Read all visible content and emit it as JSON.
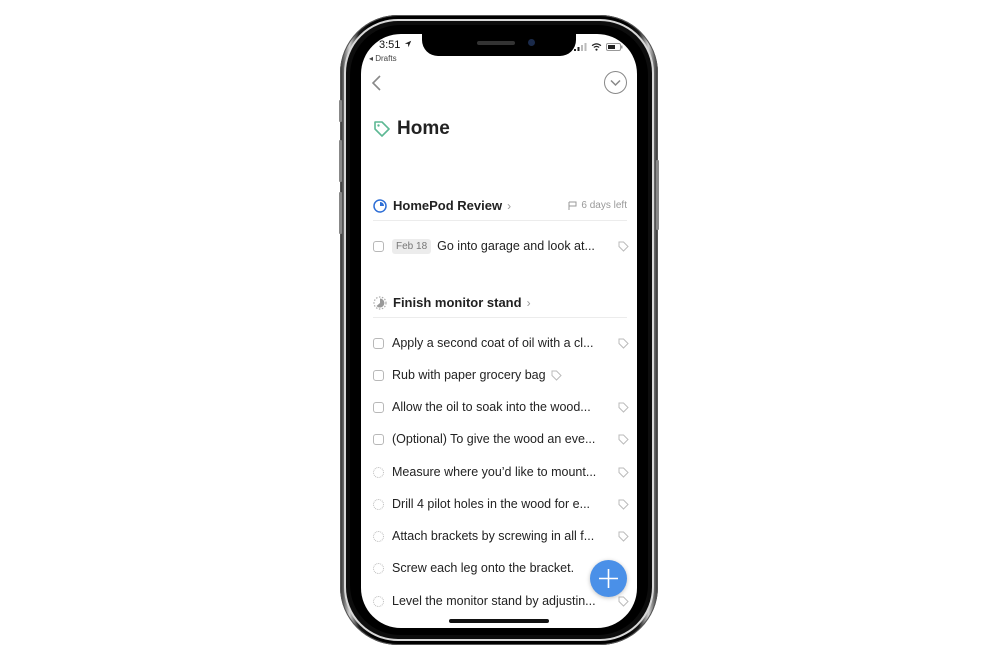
{
  "status_bar": {
    "time": "3:51",
    "back_app": "◂ Drafts",
    "location_icon": "location-arrow-icon",
    "signal_icon": "signal-icon",
    "wifi_icon": "wifi-icon",
    "battery_icon": "battery-icon"
  },
  "nav": {
    "back_icon": "chevron-left-icon",
    "menu_icon": "chevron-down-circle-icon"
  },
  "page": {
    "title": "Home",
    "title_icon": "tag-icon",
    "title_icon_color": "#5cb893"
  },
  "projects": [
    {
      "name": "HomePod Review",
      "chevron": "›",
      "icon": "progress-pie-icon",
      "icon_color": "#2f6fd6",
      "deadline": "6 days left",
      "tasks": [
        {
          "date": "Feb 18",
          "text": "Go into garage and look at...",
          "checkbox": "square"
        }
      ]
    },
    {
      "name": "Finish monitor stand",
      "chevron": "›",
      "icon": "progress-pie-icon",
      "icon_color": "#999999",
      "deadline": "",
      "tasks": [
        {
          "text": "Apply a second coat of oil with a cl...",
          "checkbox": "square"
        },
        {
          "text": "Rub with paper grocery bag",
          "checkbox": "square"
        },
        {
          "text": "Allow the oil to soak into the wood...",
          "checkbox": "square"
        },
        {
          "text": "(Optional) To give the wood an eve...",
          "checkbox": "square"
        },
        {
          "text": "Measure where you’d like to mount...",
          "checkbox": "dashed"
        },
        {
          "text": "Drill 4 pilot holes in the wood for e...",
          "checkbox": "dashed"
        },
        {
          "text": "Attach brackets by screwing in all f...",
          "checkbox": "dashed"
        },
        {
          "text": "Screw each leg onto the bracket.",
          "checkbox": "dashed"
        },
        {
          "text": "Level the monitor stand by adjustin...",
          "checkbox": "dashed"
        }
      ]
    }
  ],
  "fab": {
    "icon": "plus-icon",
    "color": "#4a90e8"
  }
}
